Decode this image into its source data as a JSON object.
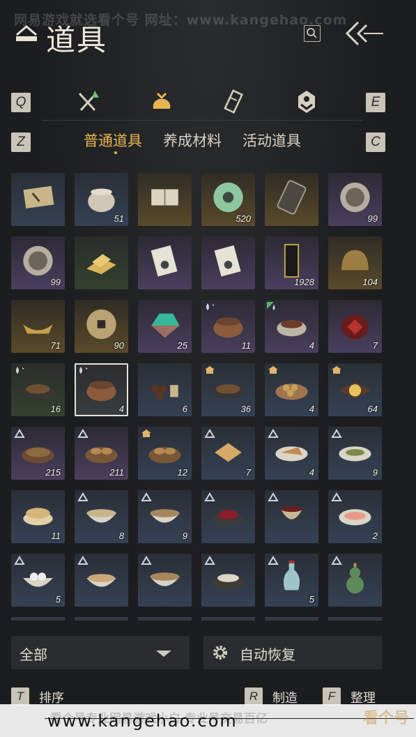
{
  "watermark_top": "网易游戏就选看个号  网址：www.kangehao.com",
  "title": "道具",
  "keys": {
    "prev_tab": "Q",
    "next_tab": "E",
    "prev_subtab": "Z",
    "next_subtab": "C"
  },
  "tabs": [
    {
      "icon": "weapon-icon"
    },
    {
      "icon": "pouch-icon",
      "active": true
    },
    {
      "icon": "scroll-icon"
    },
    {
      "icon": "gem-icon"
    }
  ],
  "subtabs": [
    "普通道具",
    "养成材料",
    "活动道具"
  ],
  "items": [
    {
      "art": "map-scroll",
      "rarity": "r-blue",
      "count": ""
    },
    {
      "art": "jar",
      "rarity": "r-blue",
      "count": "51"
    },
    {
      "art": "book",
      "rarity": "r-gold",
      "count": ""
    },
    {
      "art": "jade-disc",
      "rarity": "r-gold",
      "count": "520"
    },
    {
      "art": "token",
      "rarity": "r-gold",
      "count": ""
    },
    {
      "art": "medal",
      "rarity": "r-purple",
      "count": "99"
    },
    {
      "art": "medal",
      "rarity": "r-purple",
      "count": "99"
    },
    {
      "art": "gold-bars",
      "rarity": "r-green",
      "count": ""
    },
    {
      "art": "card",
      "rarity": "r-purple",
      "count": ""
    },
    {
      "art": "card",
      "rarity": "r-purple",
      "count": ""
    },
    {
      "art": "talisman",
      "rarity": "r-purple",
      "count": "1928"
    },
    {
      "art": "helmet",
      "rarity": "r-gold",
      "count": "104"
    },
    {
      "art": "ingot",
      "rarity": "r-gold",
      "count": "71"
    },
    {
      "art": "coin",
      "rarity": "r-gold",
      "count": "90"
    },
    {
      "art": "gem",
      "rarity": "r-purple",
      "count": "25"
    },
    {
      "art": "clay-pot",
      "rarity": "r-purple",
      "count": "11",
      "badge": "drop"
    },
    {
      "art": "meat-bowl",
      "rarity": "r-purple",
      "count": "4",
      "badge": "drop-green"
    },
    {
      "art": "wine-jar",
      "rarity": "r-purple",
      "count": "7"
    },
    {
      "art": "dish",
      "rarity": "r-green",
      "count": "16",
      "badge": "drop"
    },
    {
      "art": "clay-pot",
      "rarity": "r-gray",
      "count": "4",
      "badge": "drop",
      "selected": true
    },
    {
      "art": "tea",
      "rarity": "r-blue",
      "count": "6"
    },
    {
      "art": "dish",
      "rarity": "r-blue",
      "count": "36",
      "badge": "roof"
    },
    {
      "art": "balls",
      "rarity": "r-blue",
      "count": "4",
      "badge": "roof"
    },
    {
      "art": "plate",
      "rarity": "r-blue",
      "count": "64",
      "badge": "roof"
    },
    {
      "art": "stew",
      "rarity": "r-purple",
      "count": "215",
      "badge": "tent"
    },
    {
      "art": "buns",
      "rarity": "r-purple",
      "count": "211",
      "badge": "tent"
    },
    {
      "art": "buns",
      "rarity": "r-blue",
      "count": "12",
      "badge": "roof"
    },
    {
      "art": "cake",
      "rarity": "r-blue",
      "count": "7",
      "badge": "tent"
    },
    {
      "art": "pancake",
      "rarity": "r-blue",
      "count": "4",
      "badge": "tent"
    },
    {
      "art": "greens",
      "rarity": "r-blue",
      "count": "9",
      "badge": "tent"
    },
    {
      "art": "flatbread",
      "rarity": "r-blue",
      "count": "11"
    },
    {
      "art": "soup",
      "rarity": "r-blue",
      "count": "8",
      "badge": "tent"
    },
    {
      "art": "porridge",
      "rarity": "r-blue",
      "count": "9",
      "badge": "tent"
    },
    {
      "art": "berries",
      "rarity": "r-blue",
      "count": "",
      "badge": "tent"
    },
    {
      "art": "wine-cup",
      "rarity": "r-blue",
      "count": "",
      "badge": "tent"
    },
    {
      "art": "sashimi",
      "rarity": "r-blue",
      "count": "2",
      "badge": "tent"
    },
    {
      "art": "dumplings",
      "rarity": "r-blue",
      "count": "5",
      "badge": "tent"
    },
    {
      "art": "noodles",
      "rarity": "r-blue",
      "count": "",
      "badge": "tent"
    },
    {
      "art": "porridge",
      "rarity": "r-blue",
      "count": "",
      "badge": "tent"
    },
    {
      "art": "rice",
      "rarity": "r-blue",
      "count": "",
      "badge": "tent"
    },
    {
      "art": "vase",
      "rarity": "r-blue",
      "count": "5",
      "badge": "tent"
    },
    {
      "art": "gourd",
      "rarity": "r-blue",
      "count": "",
      "badge": "tent"
    }
  ],
  "filter": {
    "value": "全部"
  },
  "auto_restore": {
    "label": "自动恢复"
  },
  "footer": [
    {
      "key": "T",
      "label": "排序"
    },
    {
      "key": "R",
      "label": "制造"
    },
    {
      "key": "F",
      "label": "整理"
    }
  ],
  "banner": {
    "ghost": "看个号专业网易游戏小白  专业号交易百亿",
    "url": "www.kangehao.com",
    "brand": "看个号"
  },
  "colors": {
    "accent": "#e6b552",
    "panel": "#2a2c2f",
    "background": "#1d1f21"
  }
}
